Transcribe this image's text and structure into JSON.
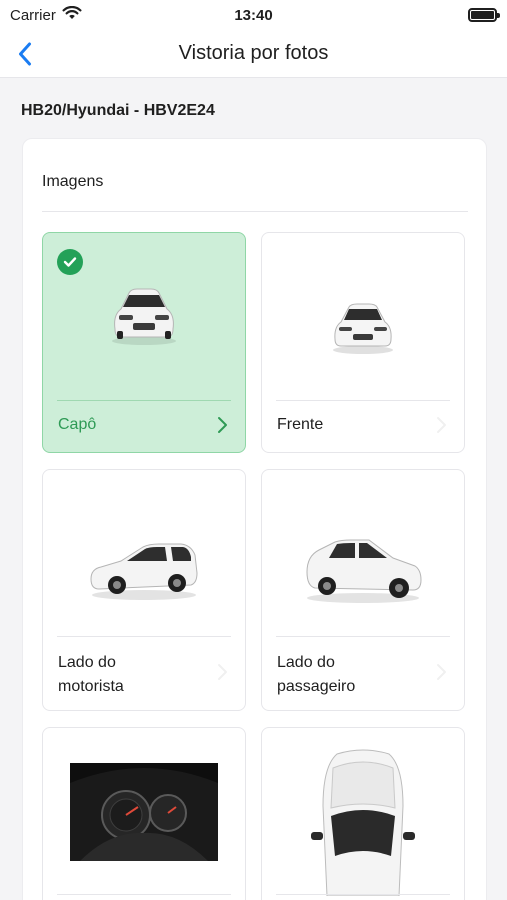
{
  "status": {
    "carrier": "Carrier",
    "time": "13:40"
  },
  "nav": {
    "title": "Vistoria por fotos"
  },
  "vehicle": {
    "title": "HB20/Hyundai - HBV2E24"
  },
  "section": {
    "title": "Imagens"
  },
  "tiles": [
    {
      "label": "Capô",
      "done": true
    },
    {
      "label": "Frente",
      "done": false
    },
    {
      "label": "Lado do\nmotorista",
      "done": false
    },
    {
      "label": "Lado do\npassageiro",
      "done": false
    },
    {
      "label": "",
      "done": false
    },
    {
      "label": "",
      "done": false
    }
  ],
  "colors": {
    "accent_blue": "#1a7cf2",
    "done_green": "#23a158",
    "done_bg": "#cdeed8"
  }
}
